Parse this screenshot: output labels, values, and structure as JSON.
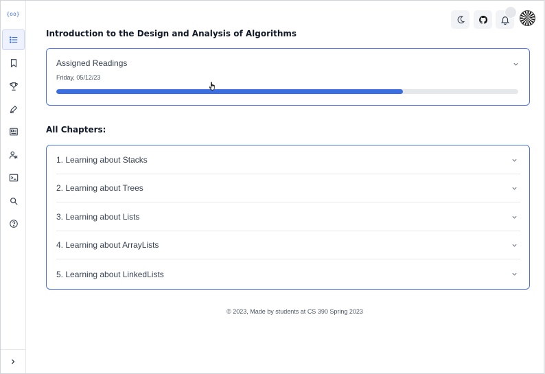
{
  "app": {
    "logo_text": "{oo}"
  },
  "sidebar": {
    "items": [
      {
        "icon": "list-icon",
        "active": true
      },
      {
        "icon": "bookmark-icon",
        "active": false
      },
      {
        "icon": "trophy-icon",
        "active": false
      },
      {
        "icon": "pen-icon",
        "active": false
      },
      {
        "icon": "newspaper-icon",
        "active": false
      },
      {
        "icon": "users-icon",
        "active": false
      },
      {
        "icon": "terminal-icon",
        "active": false
      },
      {
        "icon": "search-icon",
        "active": false
      },
      {
        "icon": "help-icon",
        "active": false
      }
    ],
    "expand_icon": "chevron-right-icon"
  },
  "header": {
    "buttons": [
      "moon-icon",
      "github-icon",
      "bell-icon"
    ],
    "avatar": "user-avatar"
  },
  "course": {
    "title": "Introduction to the Design and Analysis of Algorithms"
  },
  "assigned": {
    "title": "Assigned Readings",
    "date": "Friday, 05/12/23",
    "progress_fraction": 0.75
  },
  "chapters": {
    "heading": "All Chapters:",
    "items": [
      {
        "label": "1. Learning about Stacks"
      },
      {
        "label": "2. Learning about Trees"
      },
      {
        "label": "3. Learning about Lists"
      },
      {
        "label": "4. Learning about ArrayLists"
      },
      {
        "label": "5. Learning about LinkedLists"
      }
    ]
  },
  "footer": {
    "text": "© 2023, Made by students at CS 390 Spring 2023"
  },
  "colors": {
    "accent": "#3b6fe0",
    "card_border": "#4a74e0",
    "track": "#e5e7eb"
  }
}
